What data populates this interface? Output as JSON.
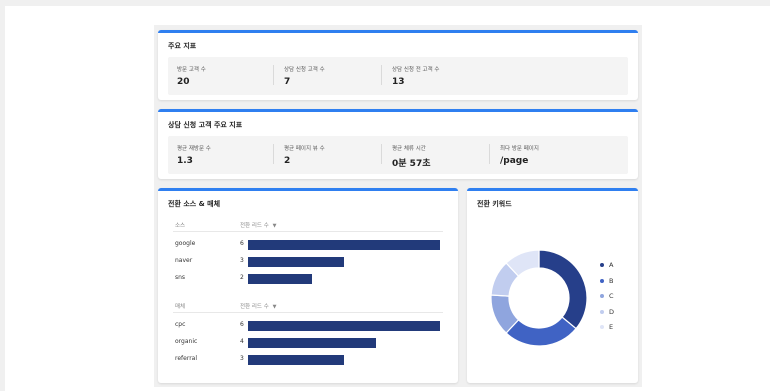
{
  "key_metrics": {
    "title": "주요 지표",
    "items": [
      {
        "label": "방문 고객 수",
        "value": "20"
      },
      {
        "label": "상담 신청 고객 수",
        "value": "7"
      },
      {
        "label": "상담 신청 전 고객 수",
        "value": "13"
      }
    ]
  },
  "consult_metrics": {
    "title": "상담 신청 고객 주요 지표",
    "items": [
      {
        "label": "평균 재방문 수",
        "value": "1.3"
      },
      {
        "label": "평균 페이지 뷰 수",
        "value": "2"
      },
      {
        "label": "평균 체류 시간",
        "value": "0분 57초"
      },
      {
        "label": "최다 방문 페이지",
        "value": "/page"
      }
    ]
  },
  "conversion_source": {
    "title": "전환 소스 & 매체",
    "source_section": {
      "header_name": "소스",
      "header_metric": "전환 리드 수",
      "sort_icon": "caret-down-icon",
      "rows": [
        {
          "name": "google",
          "count": "6",
          "value": 6
        },
        {
          "name": "naver",
          "count": "3",
          "value": 3
        },
        {
          "name": "sns",
          "count": "2",
          "value": 2
        }
      ]
    },
    "medium_section": {
      "header_name": "매체",
      "header_metric": "전환 리드 수",
      "sort_icon": "caret-down-icon",
      "rows": [
        {
          "name": "cpc",
          "count": "6",
          "value": 6
        },
        {
          "name": "organic",
          "count": "4",
          "value": 4
        },
        {
          "name": "referral",
          "count": "3",
          "value": 3
        }
      ]
    },
    "bar_color": "#223a7a",
    "max_value": 6
  },
  "conversion_keyword": {
    "title": "전환 키워드",
    "chart_data": {
      "type": "pie",
      "categories": [
        "A",
        "B",
        "C",
        "D",
        "E"
      ],
      "values": [
        36,
        26,
        14,
        12,
        12
      ],
      "colors": [
        "#263f8a",
        "#4063c4",
        "#8fa5de",
        "#c1cdef",
        "#dfe5f7"
      ],
      "legend": "right",
      "title": ""
    }
  },
  "accent_color": "#2f7ff0"
}
